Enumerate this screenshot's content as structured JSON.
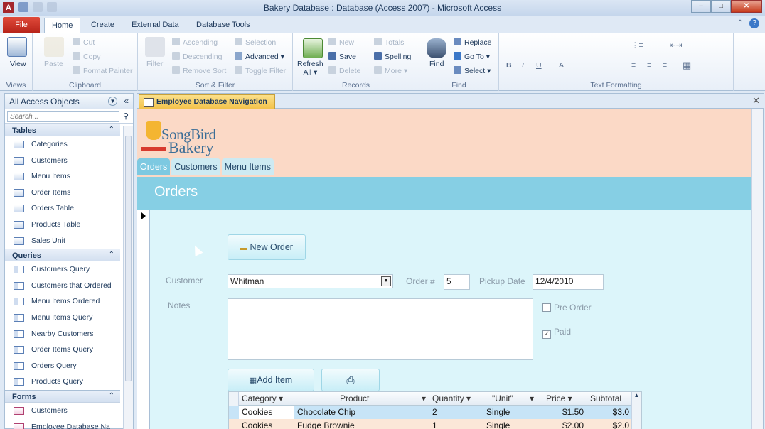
{
  "window": {
    "title": "Bakery Database : Database (Access 2007)  -  Microsoft Access",
    "app_icon": "A"
  },
  "ribbon_tabs": [
    "File",
    "Home",
    "Create",
    "External Data",
    "Database Tools"
  ],
  "ribbon": {
    "views": {
      "view": "View",
      "label": "Views"
    },
    "clipboard": {
      "paste": "Paste",
      "cut": "Cut",
      "copy": "Copy",
      "format_painter": "Format Painter",
      "label": "Clipboard"
    },
    "sort_filter": {
      "filter": "Filter",
      "ascending": "Ascending",
      "descending": "Descending",
      "remove_sort": "Remove Sort",
      "selection": "Selection",
      "advanced": "Advanced",
      "toggle_filter": "Toggle Filter",
      "label": "Sort & Filter"
    },
    "records": {
      "refresh_all": "Refresh",
      "refresh_all_2": "All",
      "new": "New",
      "save": "Save",
      "delete": "Delete",
      "totals": "Totals",
      "spelling": "Spelling",
      "more": "More",
      "label": "Records"
    },
    "find": {
      "find": "Find",
      "replace": "Replace",
      "goto": "Go To",
      "select": "Select",
      "label": "Find"
    },
    "text_formatting": {
      "label": "Text Formatting"
    }
  },
  "nav": {
    "title": "All Access Objects",
    "search_placeholder": "Search...",
    "sections": {
      "tables": {
        "title": "Tables",
        "items": [
          "Categories",
          "Customers",
          "Menu Items",
          "Order Items",
          "Orders Table",
          "Products Table",
          "Sales Unit"
        ]
      },
      "queries": {
        "title": "Queries",
        "items": [
          "Customers Query",
          "Customers that Ordered",
          "Menu Items Ordered",
          "Menu Items Query",
          "Nearby Customers",
          "Order Items Query",
          "Orders Query",
          "Products Query"
        ]
      },
      "forms": {
        "title": "Forms",
        "items": [
          "Customers",
          "Employee Database Na"
        ]
      }
    }
  },
  "document": {
    "tab_title": "Employee Database Navigation",
    "logo_line1": "SongBird",
    "logo_line2": "Bakery",
    "nav_tabs": [
      "Orders",
      "Customers",
      "Menu Items"
    ],
    "section_title": "Orders",
    "new_order": "New Order",
    "customer_label": "Customer",
    "customer_value": "Whitman",
    "order_label": "Order #",
    "order_value": "5",
    "pickup_label": "Pickup Date",
    "pickup_value": "12/4/2010",
    "notes_label": "Notes",
    "pre_order": "Pre Order",
    "paid": "Paid",
    "add_item": "Add Item",
    "grid": {
      "headers": [
        "Category",
        "Product",
        "Quantity",
        "\"Unit\"",
        "Price",
        "Subtotal"
      ],
      "rows": [
        [
          "Cookies",
          "Chocolate Chip",
          "2",
          "Single",
          "$1.50",
          "$3.0"
        ],
        [
          "Cookies",
          "Fudge Brownie",
          "1",
          "Single",
          "$2.00",
          "$2.0"
        ]
      ]
    }
  }
}
